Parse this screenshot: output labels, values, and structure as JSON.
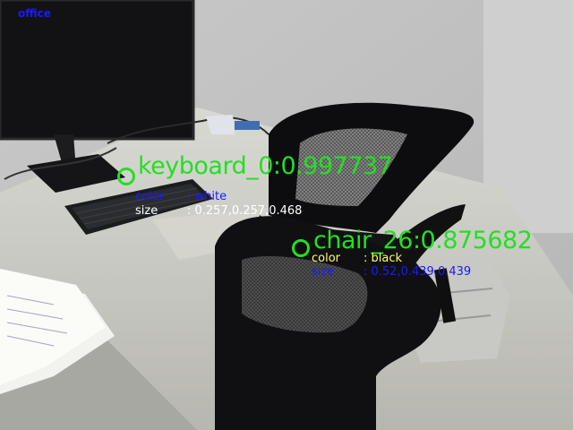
{
  "scene_label": "office",
  "detections": [
    {
      "title": "keyboard_0:0.997737",
      "color_key": "color",
      "color_value": ": white",
      "size_key": "size",
      "size_value": ": 0.257,0.257,0.468",
      "color_row_color": "#1a1aff",
      "size_row_color": "#ffffff"
    },
    {
      "title": "chair_26:0.875682",
      "color_key": "color",
      "color_value": ": black",
      "size_key": "size",
      "size_value": ": 0.52,0.439,0.439",
      "color_row_color": "#ffff66",
      "size_row_color": "#1a1aff"
    }
  ],
  "overlay_color": "#22e022"
}
